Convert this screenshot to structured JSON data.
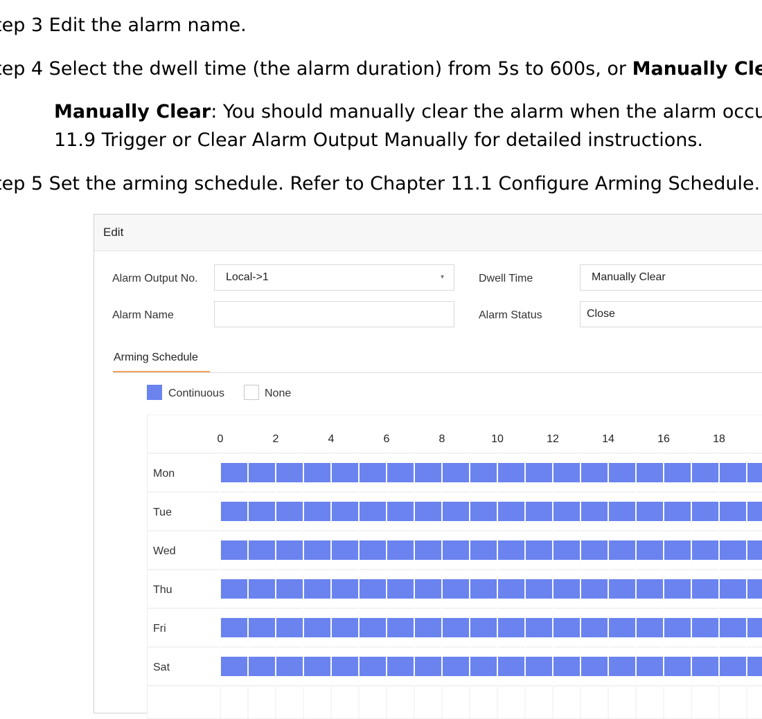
{
  "document": {
    "step3": "tep 3 Edit the alarm name.",
    "step4_prefix": "tep 4 Select the dwell time (the alarm duration) from 5s to 600s, or ",
    "step4_bold": "Manually Cle",
    "note_bold": "Manually Clear",
    "note_text": ": You should manually clear the alarm when the alarm occur",
    "note_line2": "11.9 Trigger or Clear Alarm Output Manually for detailed instructions.",
    "step5": "tep 5 Set the arming schedule. Refer to Chapter 11.1 Configure Arming Schedule."
  },
  "dialog": {
    "title": "Edit",
    "alarm_output_label": "Alarm Output No.",
    "alarm_output_value": "Local->1",
    "dwell_time_label": "Dwell Time",
    "dwell_time_value": "Manually Clear",
    "alarm_name_label": "Alarm Name",
    "alarm_name_value": "",
    "alarm_status_label": "Alarm Status",
    "alarm_status_value": "Close",
    "tab_label": "Arming Schedule"
  },
  "legend": {
    "continuous": "Continuous",
    "none": "None"
  },
  "schedule": {
    "hour_labels": [
      "0",
      "2",
      "4",
      "6",
      "8",
      "10",
      "12",
      "14",
      "16",
      "18"
    ],
    "days": [
      "Mon",
      "Tue",
      "Wed",
      "Thu",
      "Fri",
      "Sat"
    ],
    "continuous_color": "#6b83ef",
    "segments_per_day": [
      [
        0,
        24
      ],
      [
        0,
        24
      ],
      [
        0,
        24
      ],
      [
        0,
        24
      ],
      [
        0,
        24
      ],
      [
        0,
        24
      ]
    ]
  }
}
